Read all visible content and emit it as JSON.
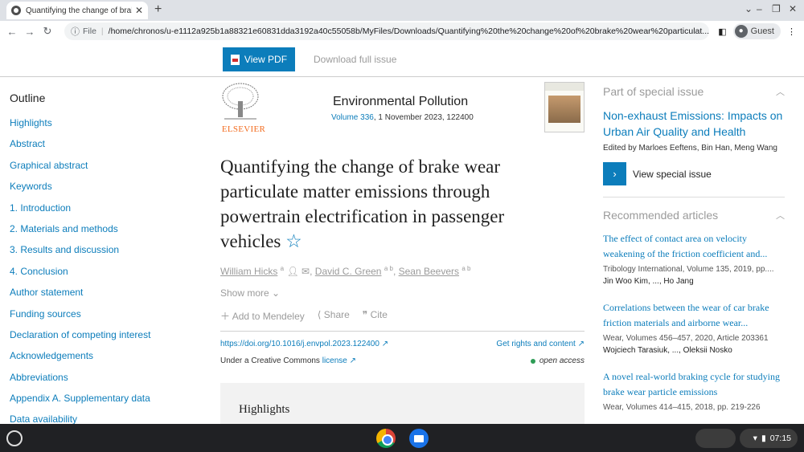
{
  "browser": {
    "tab_title": "Quantifying the change of brake",
    "url_scheme": "File",
    "url": "/home/chronos/u-e1112a925b1a88321e60831dda3192a40c55058b/MyFiles/Downloads/Quantifying%20the%20change%20of%20brake%20wear%20particulat...",
    "profile": "Guest"
  },
  "actions": {
    "view_pdf": "View PDF",
    "download_issue": "Download full issue"
  },
  "outline": {
    "heading": "Outline",
    "items": [
      "Highlights",
      "Abstract",
      "Graphical abstract",
      "Keywords",
      "1. Introduction",
      "2. Materials and methods",
      "3. Results and discussion",
      "4. Conclusion",
      "Author statement",
      "Funding sources",
      "Declaration of competing interest",
      "Acknowledgements",
      "Abbreviations",
      "Appendix A. Supplementary data",
      "Data availability"
    ]
  },
  "journal": {
    "publisher": "ELSEVIER",
    "name": "Environmental Pollution",
    "volume_link": "Volume 336",
    "meta_rest": ", 1 November 2023, 122400"
  },
  "article": {
    "title": "Quantifying the change of brake wear particulate matter emissions through powertrain electrification in passenger vehicles",
    "star": "☆",
    "authors": [
      {
        "name": "William Hicks",
        "sup": "a"
      },
      {
        "name": "David C. Green",
        "sup": "a b"
      },
      {
        "name": "Sean Beevers",
        "sup": "a b"
      }
    ],
    "show_more": "Show more",
    "tools": [
      "Add to Mendeley",
      "Share",
      "Cite"
    ],
    "doi": "https://doi.org/10.1016/j.envpol.2023.122400",
    "rights": "Get rights and content",
    "cc_text": "Under a Creative Commons",
    "cc_link": "license",
    "open_access": "open access",
    "highlights_heading": "Highlights"
  },
  "special_issue": {
    "heading": "Part of special issue",
    "title": "Non-exhaust Emissions: Impacts on Urban Air Quality and Health",
    "editors": "Edited by Marloes Eeftens, Bin Han, Meng Wang",
    "view_label": "View special issue"
  },
  "recommended": {
    "heading": "Recommended articles",
    "items": [
      {
        "title": "The effect of contact area on velocity weakening of the friction coefficient and...",
        "source": "Tribology International, Volume 135, 2019, pp....",
        "authors": "Jin Woo Kim, ..., Ho Jang"
      },
      {
        "title": "Correlations between the wear of car brake friction materials and airborne wear...",
        "source": "Wear, Volumes 456–457, 2020, Article 203361",
        "authors": "Wojciech Tarasiuk, ..., Oleksii Nosko"
      },
      {
        "title": "A novel real-world braking cycle for studying brake wear particle emissions",
        "source": "Wear, Volumes 414–415, 2018, pp. 219-226",
        "authors": ""
      }
    ]
  },
  "system": {
    "time": "07:15"
  }
}
